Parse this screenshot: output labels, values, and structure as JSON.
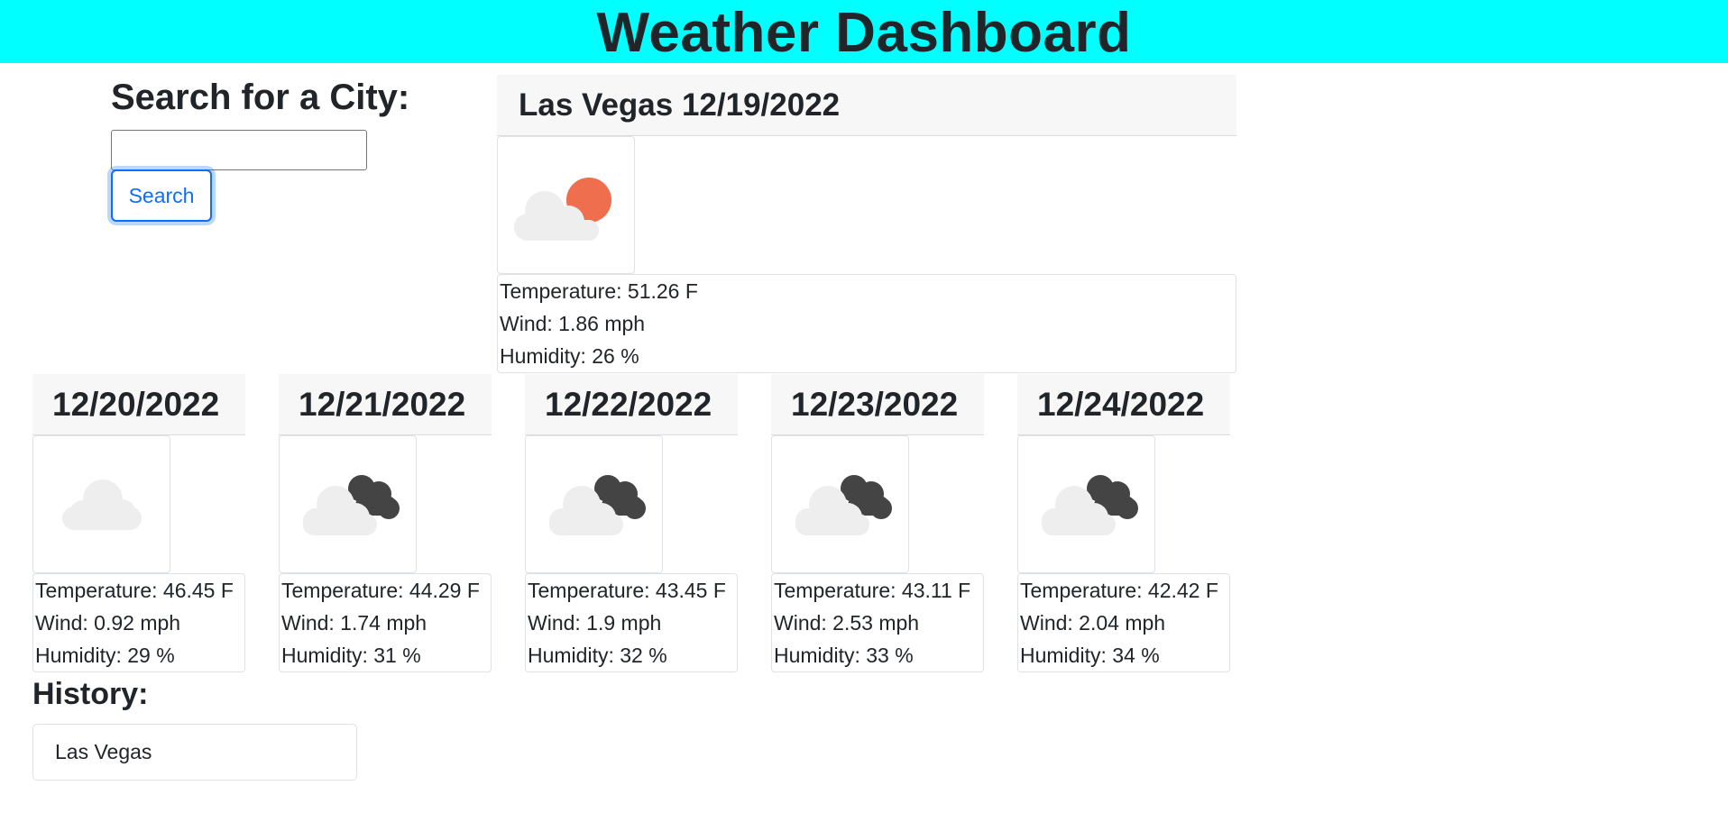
{
  "header": {
    "title": "Weather Dashboard",
    "bg_color": "#00ffff"
  },
  "search": {
    "label": "Search for a City:",
    "value": "",
    "placeholder": "",
    "button_label": "Search"
  },
  "current": {
    "title": "Las Vegas 12/19/2022",
    "icon": "few-clouds-day-icon",
    "temperature": "Temperature: 51.26 F",
    "wind": "Wind: 1.86 mph",
    "humidity": "Humidity: 26 %"
  },
  "forecast": [
    {
      "date": "12/20/2022",
      "icon": "cloud-icon",
      "temperature": "Temperature: 46.45 F",
      "wind": "Wind: 0.92 mph",
      "humidity": "Humidity: 29 %"
    },
    {
      "date": "12/21/2022",
      "icon": "broken-clouds-icon",
      "temperature": "Temperature: 44.29 F",
      "wind": "Wind: 1.74 mph",
      "humidity": "Humidity: 31 %"
    },
    {
      "date": "12/22/2022",
      "icon": "broken-clouds-icon",
      "temperature": "Temperature: 43.45 F",
      "wind": "Wind: 1.9 mph",
      "humidity": "Humidity: 32 %"
    },
    {
      "date": "12/23/2022",
      "icon": "broken-clouds-icon",
      "temperature": "Temperature: 43.11 F",
      "wind": "Wind: 2.53 mph",
      "humidity": "Humidity: 33 %"
    },
    {
      "date": "12/24/2022",
      "icon": "broken-clouds-icon",
      "temperature": "Temperature: 42.42 F",
      "wind": "Wind: 2.04 mph",
      "humidity": "Humidity: 34 %"
    }
  ],
  "history": {
    "label": "History:",
    "items": [
      "Las Vegas"
    ]
  },
  "colors": {
    "sun": "#ee6e4d",
    "light_cloud": "#eeeeee",
    "dark_cloud": "#444444",
    "button_blue": "#0d6efd"
  }
}
